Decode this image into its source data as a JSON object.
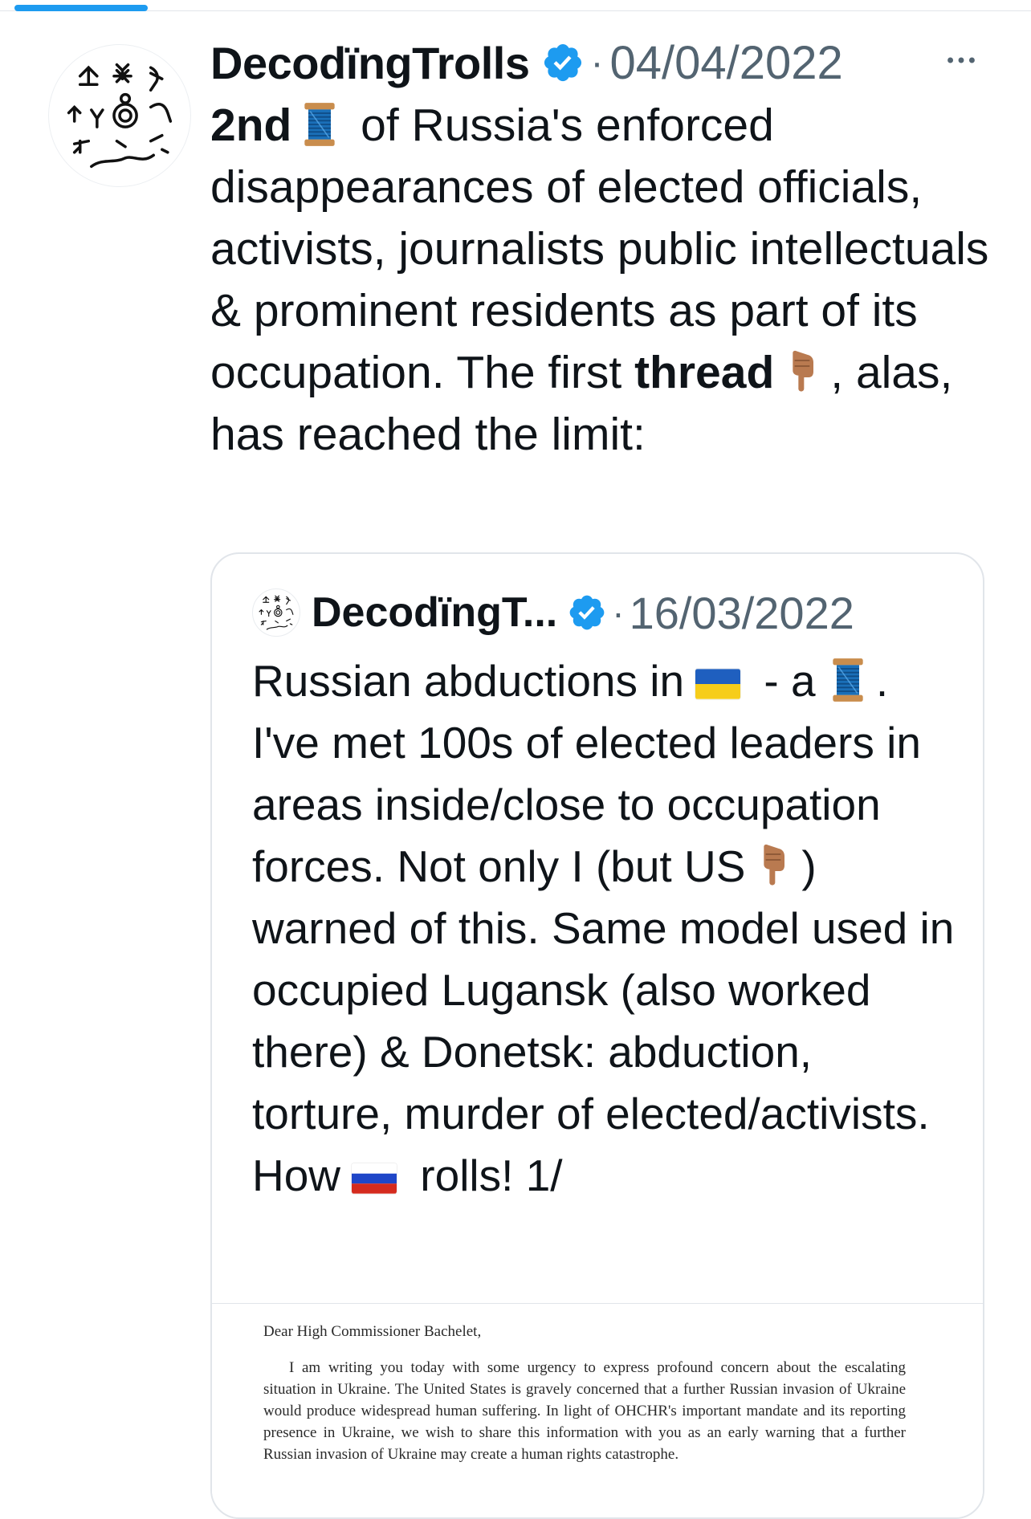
{
  "tweet": {
    "author": "DecodïngTrolls",
    "dot": "·",
    "date": "04/04/2022",
    "text": {
      "t1": "2nd",
      "t2": " of Russia's enforced disappearances of elected officials, activists, journalists public intellectuals & prominent residents as part of its occupation. The first ",
      "t3": "thread",
      "t4": ", alas, has reached the limit:"
    }
  },
  "quote": {
    "author": "DecodïngT...",
    "dot": "·",
    "date": "16/03/2022",
    "text": {
      "q1": "Russian abductions in",
      "q2": " - a",
      "q3": ". I've met 100s of elected leaders in areas inside/close to occupation forces. Not only I (but US",
      "q4": ") warned of this. Same model used in occupied Lugansk (also worked there) & Donetsk: abduction, torture, murder of elected/activists. How",
      "q5": " rolls! 1/"
    },
    "document": {
      "salutation": "Dear High Commissioner Bachelet,",
      "body": "I am writing you today with some urgency to express profound concern about the escalating situation in Ukraine. The United States is gravely concerned that a further Russian invasion of Ukraine would produce widespread human suffering. In light of OHCHR's important mandate and its reporting presence in Ukraine, we wish to share this information with you as an early warning that a further Russian invasion of Ukraine may create a human rights catastrophe."
    }
  },
  "icons": {
    "verified": "verified-badge-icon",
    "more": "more-options-icon",
    "thread": "spool-of-thread-emoji",
    "point_down": "backhand-index-pointing-down-emoji",
    "flag_ua": "ukraine-flag-emoji",
    "flag_ru": "russia-flag-emoji"
  },
  "colors": {
    "accent": "#1d9bf0",
    "secondary_text": "#536471",
    "border": "#e1e5ea"
  }
}
